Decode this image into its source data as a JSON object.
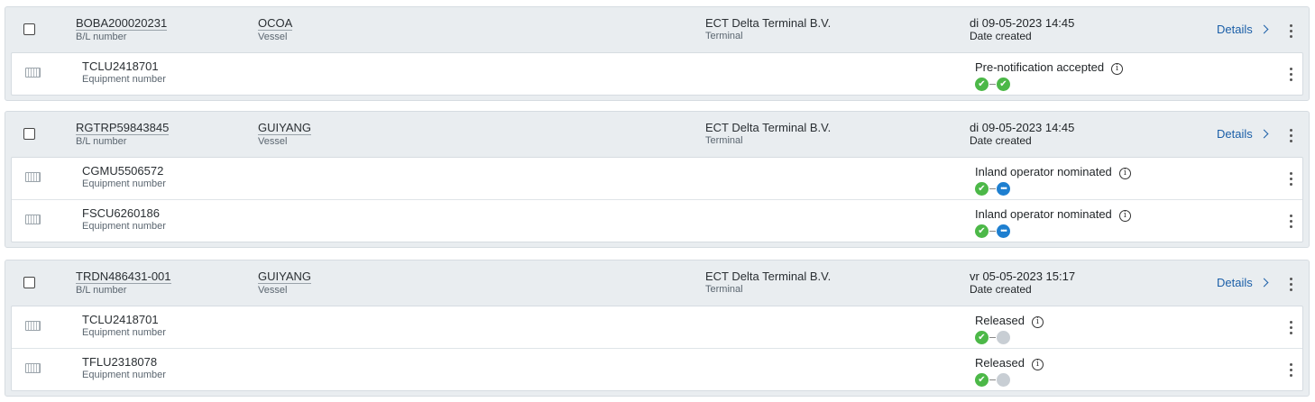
{
  "colors": {
    "accent": "#1b5fa8",
    "status_done": "#4cb848",
    "status_active": "#1e7fd0",
    "status_pending": "#c8ced4"
  },
  "labels": {
    "bl_number": "B/L number",
    "vessel": "Vessel",
    "terminal": "Terminal",
    "date_created": "Date created",
    "equipment_number": "Equipment number",
    "details": "Details"
  },
  "groups": [
    {
      "bl_number": "BOBA200020231",
      "vessel": "OCOA",
      "terminal": "ECT Delta Terminal B.V.",
      "date": "di 09-05-2023 14:45",
      "rows": [
        {
          "equipment": "TCLU2418701",
          "status": "Pre-notification accepted",
          "steps": [
            "done",
            "done"
          ]
        }
      ]
    },
    {
      "bl_number": "RGTRP59843845",
      "vessel": "GUIYANG",
      "terminal": "ECT Delta Terminal B.V.",
      "date": "di 09-05-2023 14:45",
      "rows": [
        {
          "equipment": "CGMU5506572",
          "status": "Inland operator nominated",
          "steps": [
            "done",
            "active"
          ]
        },
        {
          "equipment": "FSCU6260186",
          "status": "Inland operator nominated",
          "steps": [
            "done",
            "active"
          ]
        }
      ]
    },
    {
      "bl_number": "TRDN486431-001",
      "vessel": "GUIYANG",
      "terminal": "ECT Delta Terminal B.V.",
      "date": "vr 05-05-2023 15:17",
      "rows": [
        {
          "equipment": "TCLU2418701",
          "status": "Released",
          "steps": [
            "done",
            "pending"
          ]
        },
        {
          "equipment": "TFLU2318078",
          "status": "Released",
          "steps": [
            "done",
            "pending"
          ]
        }
      ]
    }
  ]
}
